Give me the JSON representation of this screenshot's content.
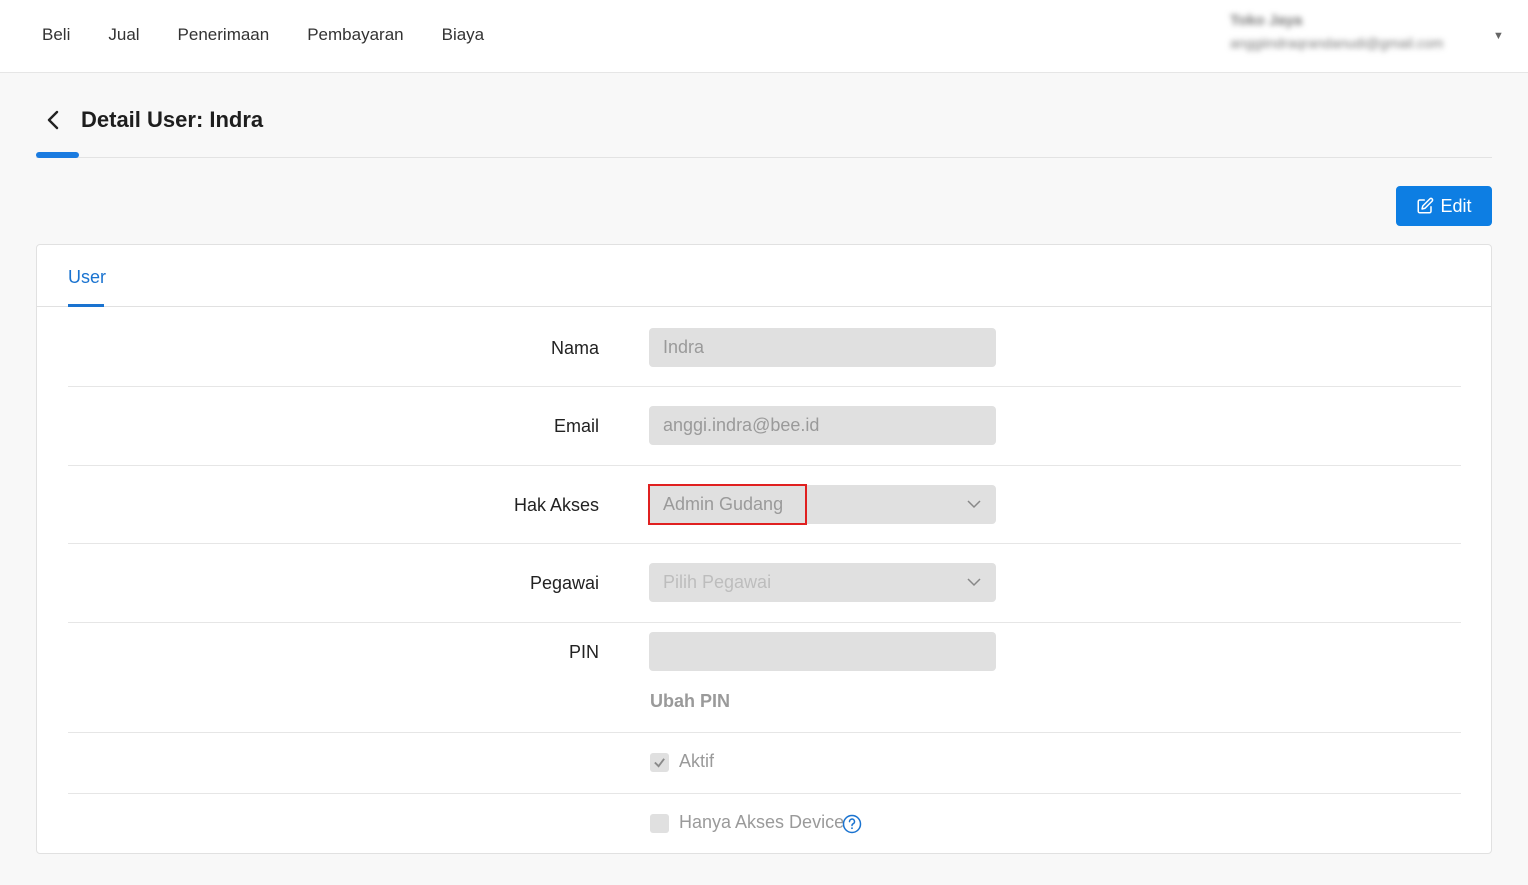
{
  "nav": {
    "items": [
      "Beli",
      "Jual",
      "Penerimaan",
      "Pembayaran",
      "Biaya"
    ]
  },
  "account": {
    "name": "Toko Jaya",
    "email": "anggiindraqrandanudi@gmail.com"
  },
  "page": {
    "title": "Detail User: Indra"
  },
  "toolbar": {
    "edit_label": "Edit"
  },
  "tabs": {
    "user": "User"
  },
  "form": {
    "nama": {
      "label": "Nama",
      "value": "Indra"
    },
    "email": {
      "label": "Email",
      "value": "anggi.indra@bee.id"
    },
    "hak_akses": {
      "label": "Hak Akses",
      "value": "Admin Gudang"
    },
    "pegawai": {
      "label": "Pegawai",
      "placeholder": "Pilih Pegawai"
    },
    "pin": {
      "label": "PIN",
      "value": "",
      "change_link": "Ubah PIN"
    },
    "aktif": {
      "label": "Aktif",
      "checked": true
    },
    "hanya_akses_device": {
      "label": "Hanya Akses Device",
      "checked": false
    }
  },
  "colors": {
    "accent": "#0d7ee3",
    "highlight": "#e02020"
  }
}
